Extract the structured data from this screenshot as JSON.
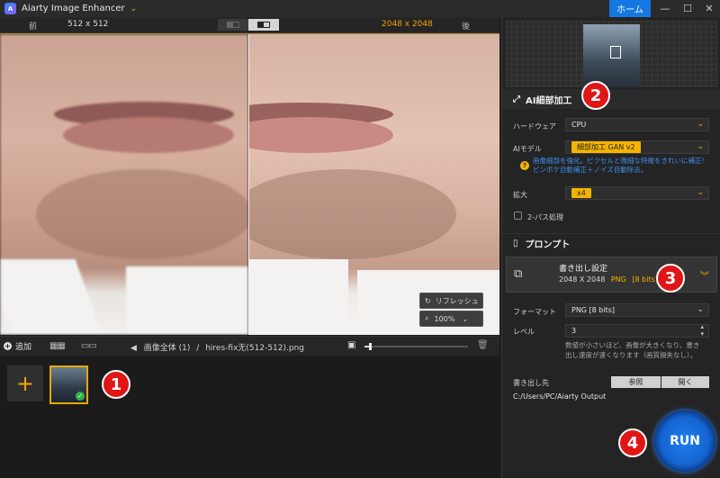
{
  "window": {
    "title": "Aiarty Image Enhancer",
    "home_label": "ホーム",
    "minimize": "—",
    "maximize": "☐",
    "close": "✕",
    "dropdown_icon": "chevron-down-icon"
  },
  "compare": {
    "before_label": "前",
    "before_size": "512 x 512",
    "after_size": "2048 x 2048",
    "after_label": "後"
  },
  "overlay": {
    "refresh_label": "リフレッシュ",
    "zoom_value": "100%"
  },
  "toolbar": {
    "add_label": "追加",
    "breadcrumb_root": "画像全体 (1)",
    "breadcrumb_sep": "/",
    "file_name": "hires-fix无(512-512).png",
    "zoom_slider_level": 0.05
  },
  "badges": [
    "1",
    "2",
    "3",
    "4"
  ],
  "panel": {
    "detail_title": "AI細部加工",
    "hardware_label": "ハードウェア",
    "hardware_value": "CPU",
    "model_label": "AIモデル",
    "model_value": "細部加工 GAN v2",
    "model_hint_line1": "画像細部を強化。ピクセルと微細な特徴をきれいに補正!",
    "model_hint_line2": "ピンボケ自動補正＋ノイズ自動除去。",
    "scale_label": "拡大",
    "scale_value": "x4",
    "twopass_label": "2-パス処理",
    "prompt_title": "プロンプト",
    "export_title": "書き出し設定",
    "export_size": "2048 X 2048",
    "export_format": "PNG",
    "export_bits": "[8 bits]",
    "format_label": "フォーマット",
    "format_value": "PNG   [8 bits]",
    "level_label": "レベル",
    "level_value": "3",
    "level_hint_line1": "数値が小さいほど、画像が大きくなり、書き",
    "level_hint_line2": "出し速度が速くなります（画質損失なし）。",
    "output_label": "書き出し先",
    "browse_label": "参照",
    "open_label": "開く",
    "output_path": "C:/Users/PC/Aiarty Output",
    "run_label": "RUN"
  },
  "colors": {
    "accent_gold": "#f4b400",
    "home_blue": "#1577e3",
    "badge_red": "#e01515",
    "run_blue": "#1e7df0",
    "hint_blue": "#3d8eea"
  }
}
